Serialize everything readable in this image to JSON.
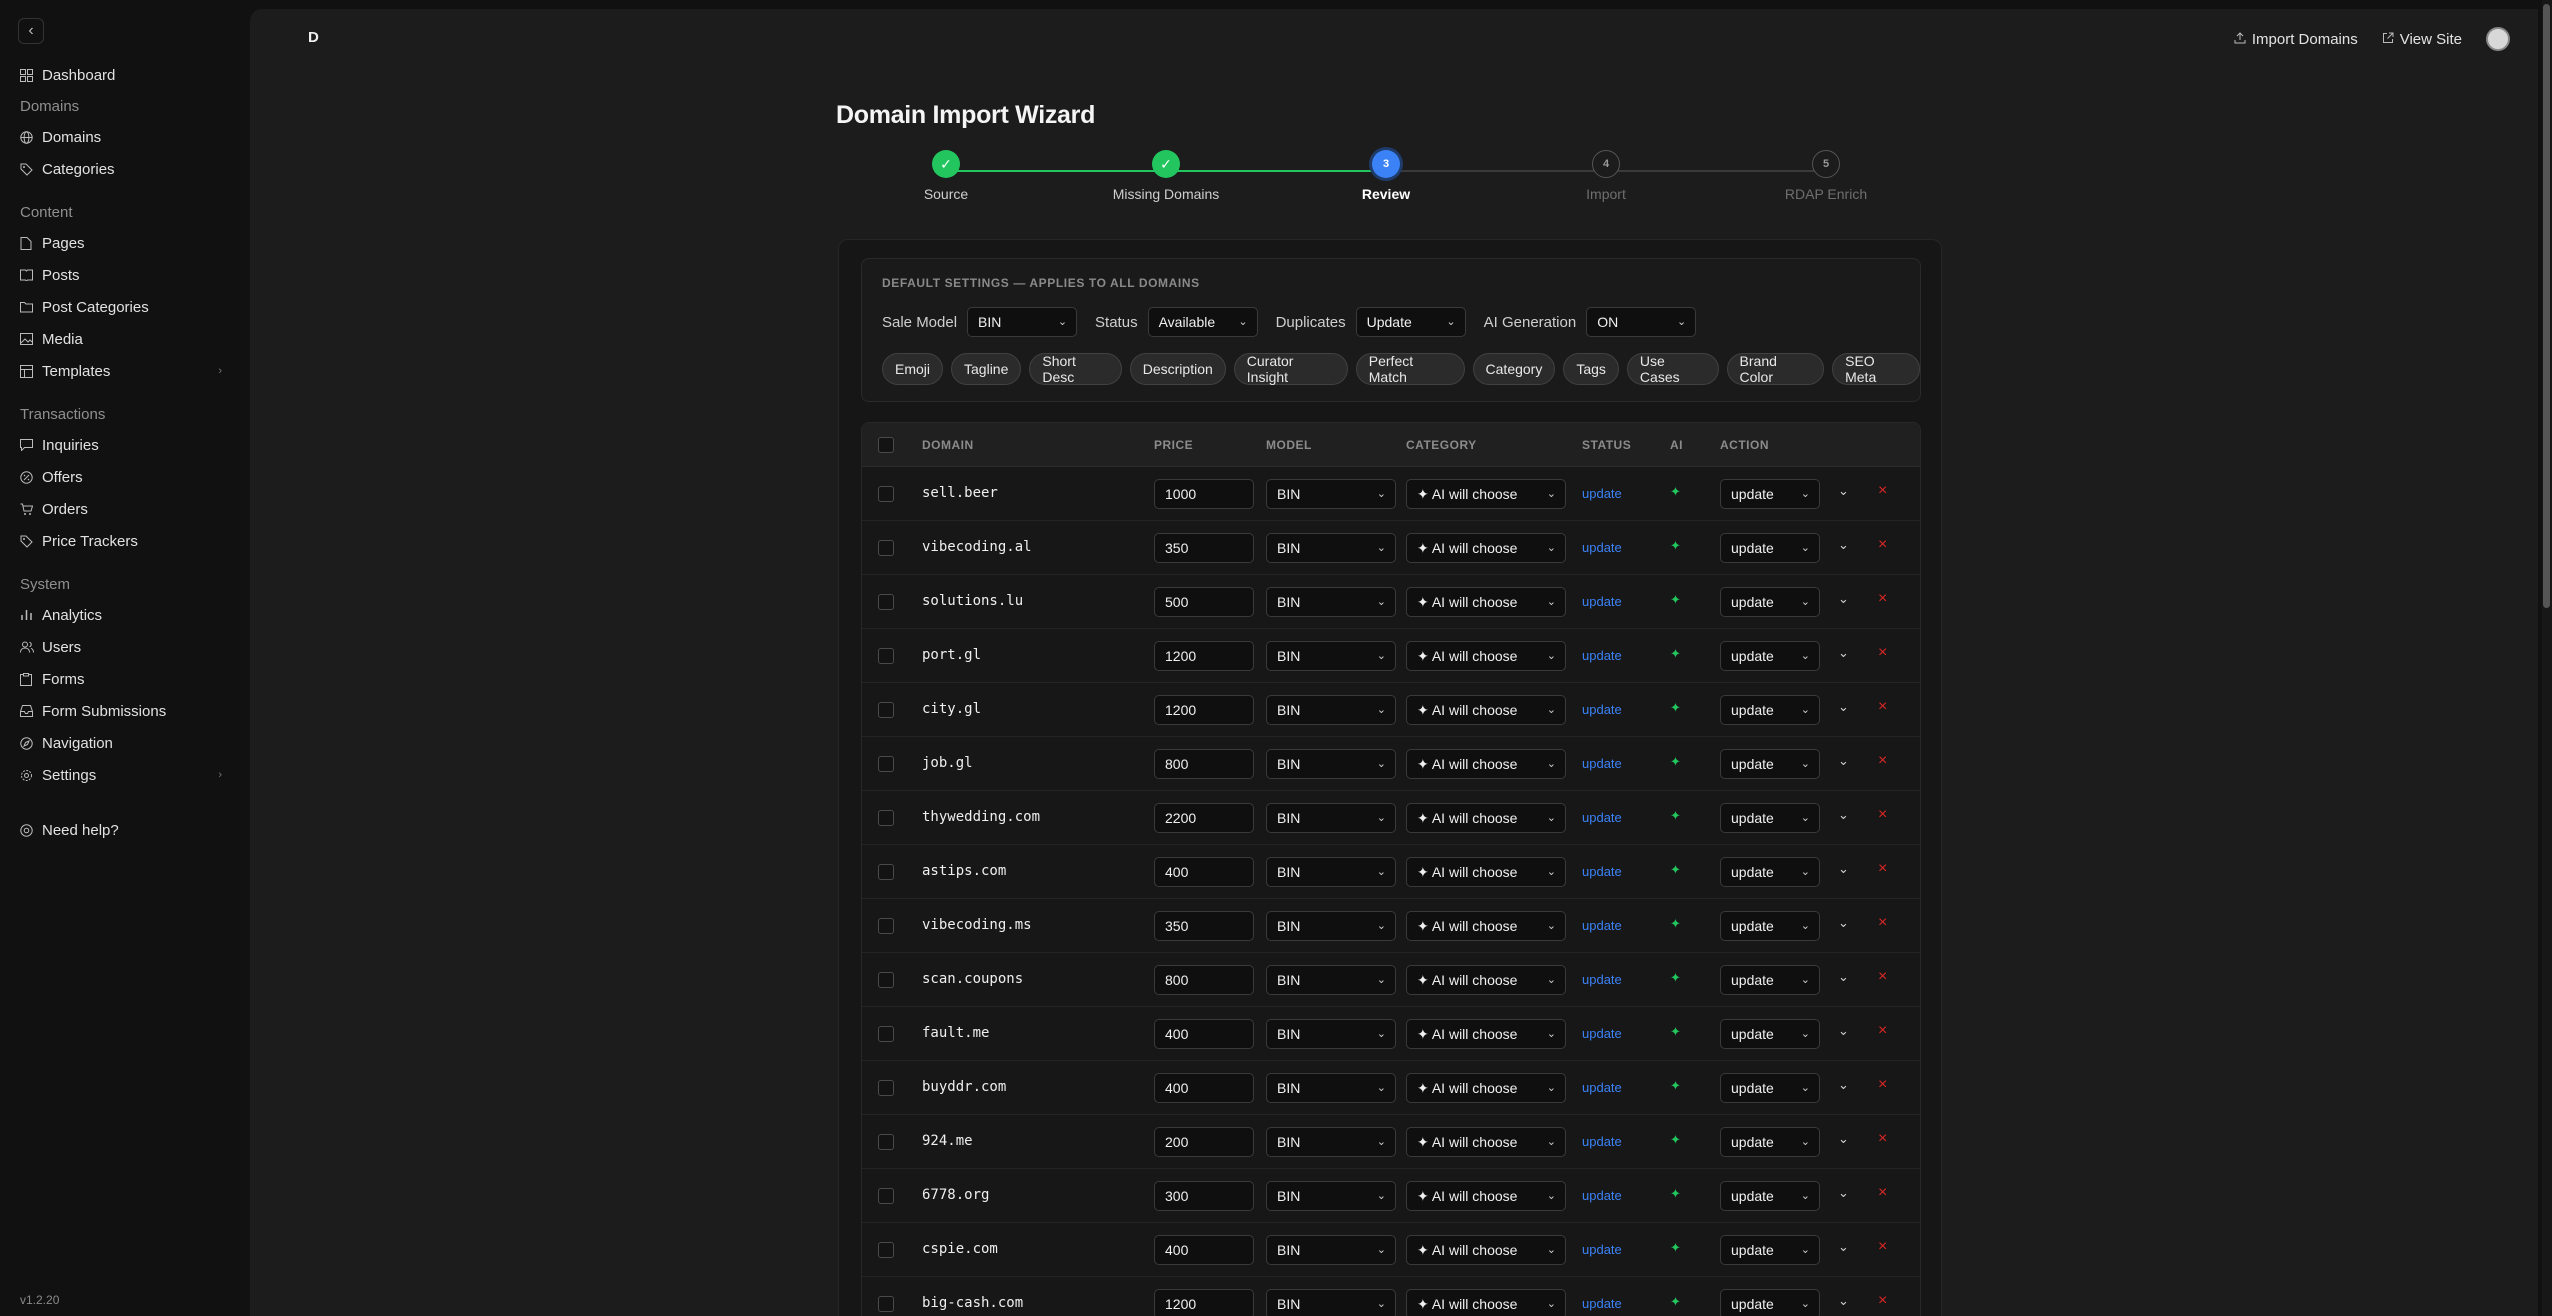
{
  "sidebar": {
    "dashboard": "Dashboard",
    "section_domains": "Domains",
    "domains": "Domains",
    "categories": "Categories",
    "section_content": "Content",
    "pages": "Pages",
    "posts": "Posts",
    "post_categories": "Post Categories",
    "media": "Media",
    "templates": "Templates",
    "section_transactions": "Transactions",
    "inquiries": "Inquiries",
    "offers": "Offers",
    "orders": "Orders",
    "price_trackers": "Price Trackers",
    "section_system": "System",
    "analytics": "Analytics",
    "users": "Users",
    "forms": "Forms",
    "form_submissions": "Form Submissions",
    "navigation": "Navigation",
    "settings": "Settings",
    "need_help": "Need help?",
    "version": "v1.2.20"
  },
  "header": {
    "brand": "D",
    "import_domains": "Import Domains",
    "view_site": "View Site"
  },
  "page_title": "Domain Import Wizard",
  "steps": [
    {
      "num": "1",
      "label": "Source",
      "state": "done"
    },
    {
      "num": "2",
      "label": "Missing Domains",
      "state": "done"
    },
    {
      "num": "3",
      "label": "Review",
      "state": "active"
    },
    {
      "num": "4",
      "label": "Import",
      "state": "todo"
    },
    {
      "num": "5",
      "label": "RDAP Enrich",
      "state": "todo"
    }
  ],
  "defaults": {
    "title": "DEFAULT SETTINGS — APPLIES TO ALL DOMAINS",
    "sale_model_label": "Sale Model",
    "sale_model_value": "BIN",
    "status_label": "Status",
    "status_value": "Available",
    "duplicates_label": "Duplicates",
    "duplicates_value": "Update",
    "ai_generation_label": "AI Generation",
    "ai_generation_value": "ON",
    "chips": [
      "Emoji",
      "Tagline",
      "Short Desc",
      "Description",
      "Curator Insight",
      "Perfect Match",
      "Category",
      "Tags",
      "Use Cases",
      "Brand Color",
      "SEO Meta"
    ]
  },
  "table": {
    "headers": {
      "domain": "DOMAIN",
      "price": "PRICE",
      "model": "MODEL",
      "category": "CATEGORY",
      "status": "STATUS",
      "ai": "AI",
      "action": "ACTION"
    },
    "rows": [
      {
        "domain": "sell.beer",
        "price": "1000",
        "model": "BIN",
        "category": "✦ AI will choose",
        "status": "update",
        "ai": "✦",
        "action": "update"
      },
      {
        "domain": "vibecoding.al",
        "price": "350",
        "model": "BIN",
        "category": "✦ AI will choose",
        "status": "update",
        "ai": "✦",
        "action": "update"
      },
      {
        "domain": "solutions.lu",
        "price": "500",
        "model": "BIN",
        "category": "✦ AI will choose",
        "status": "update",
        "ai": "✦",
        "action": "update"
      },
      {
        "domain": "port.gl",
        "price": "1200",
        "model": "BIN",
        "category": "✦ AI will choose",
        "status": "update",
        "ai": "✦",
        "action": "update"
      },
      {
        "domain": "city.gl",
        "price": "1200",
        "model": "BIN",
        "category": "✦ AI will choose",
        "status": "update",
        "ai": "✦",
        "action": "update"
      },
      {
        "domain": "job.gl",
        "price": "800",
        "model": "BIN",
        "category": "✦ AI will choose",
        "status": "update",
        "ai": "✦",
        "action": "update"
      },
      {
        "domain": "thywedding.com",
        "price": "2200",
        "model": "BIN",
        "category": "✦ AI will choose",
        "status": "update",
        "ai": "✦",
        "action": "update"
      },
      {
        "domain": "astips.com",
        "price": "400",
        "model": "BIN",
        "category": "✦ AI will choose",
        "status": "update",
        "ai": "✦",
        "action": "update"
      },
      {
        "domain": "vibecoding.ms",
        "price": "350",
        "model": "BIN",
        "category": "✦ AI will choose",
        "status": "update",
        "ai": "✦",
        "action": "update"
      },
      {
        "domain": "scan.coupons",
        "price": "800",
        "model": "BIN",
        "category": "✦ AI will choose",
        "status": "update",
        "ai": "✦",
        "action": "update"
      },
      {
        "domain": "fault.me",
        "price": "400",
        "model": "BIN",
        "category": "✦ AI will choose",
        "status": "update",
        "ai": "✦",
        "action": "update"
      },
      {
        "domain": "buyddr.com",
        "price": "400",
        "model": "BIN",
        "category": "✦ AI will choose",
        "status": "update",
        "ai": "✦",
        "action": "update"
      },
      {
        "domain": "924.me",
        "price": "200",
        "model": "BIN",
        "category": "✦ AI will choose",
        "status": "update",
        "ai": "✦",
        "action": "update"
      },
      {
        "domain": "6778.org",
        "price": "300",
        "model": "BIN",
        "category": "✦ AI will choose",
        "status": "update",
        "ai": "✦",
        "action": "update"
      },
      {
        "domain": "cspie.com",
        "price": "400",
        "model": "BIN",
        "category": "✦ AI will choose",
        "status": "update",
        "ai": "✦",
        "action": "update"
      },
      {
        "domain": "big-cash.com",
        "price": "1200",
        "model": "BIN",
        "category": "✦ AI will choose",
        "status": "update",
        "ai": "✦",
        "action": "update"
      }
    ]
  },
  "colors": {
    "step_done": "#22c55e",
    "step_active": "#3b82f6",
    "status_link": "#3b82f6",
    "ai_spark": "#22c55e",
    "remove": "#dc2626"
  }
}
